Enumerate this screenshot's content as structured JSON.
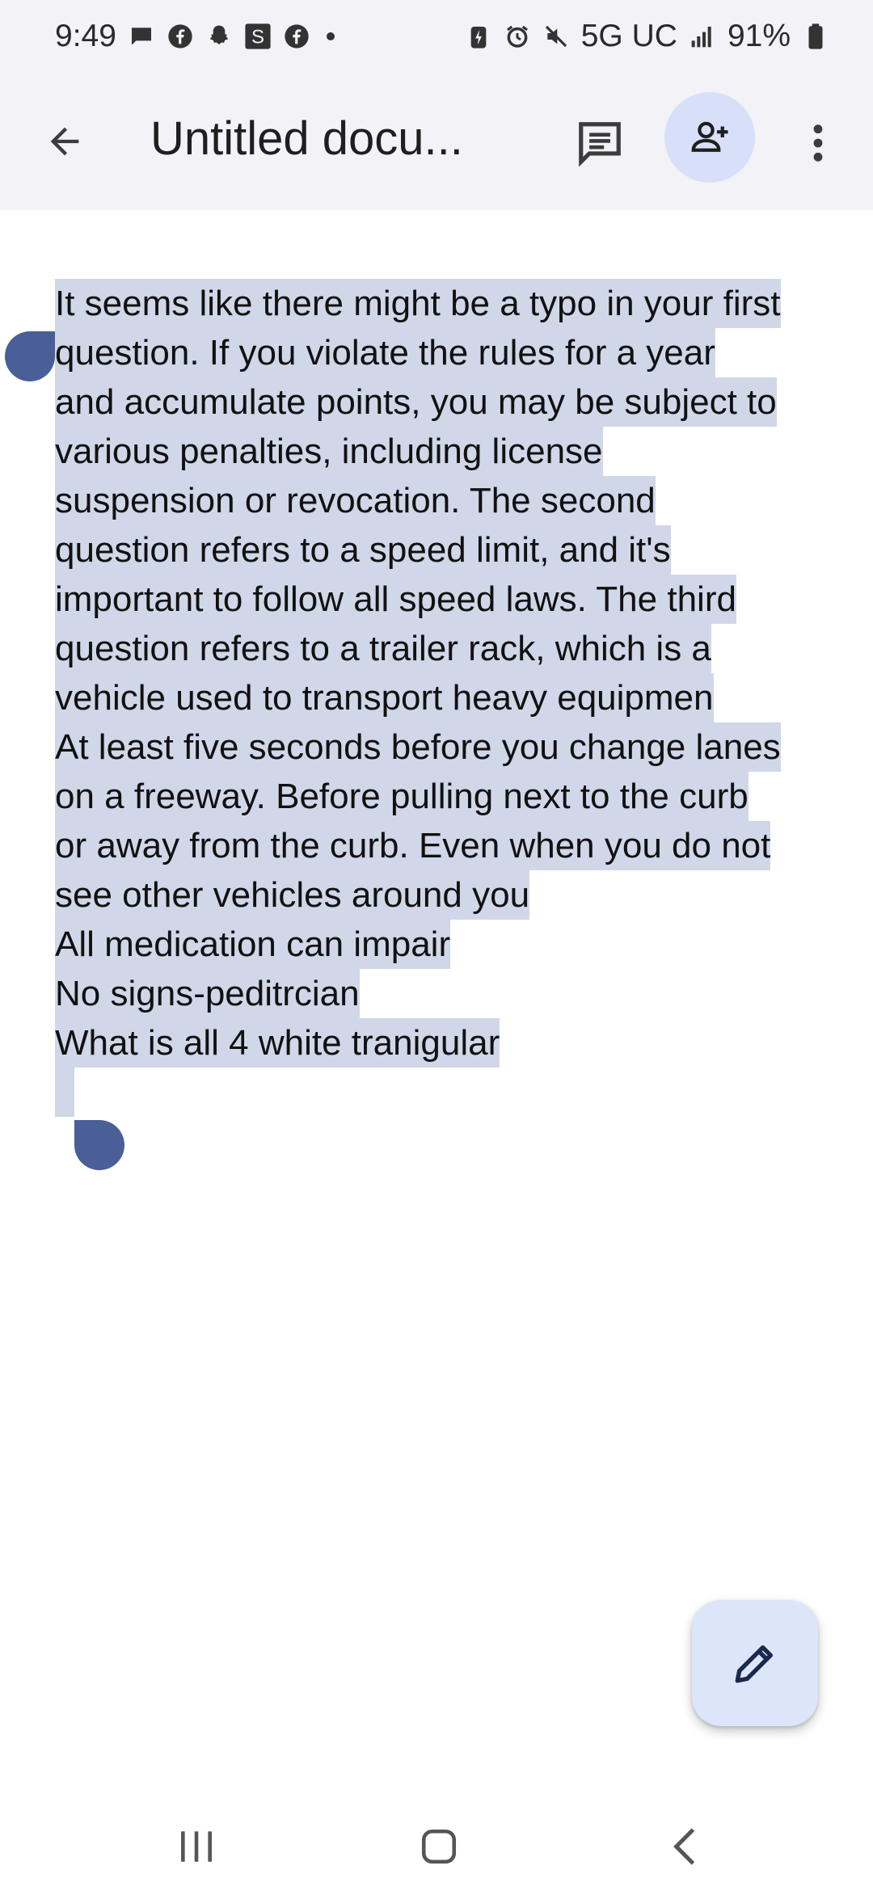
{
  "status_bar": {
    "time": "9:49",
    "network": "5G UC",
    "battery": "91%",
    "left_icons": [
      "messages-icon",
      "facebook-icon",
      "snapchat-icon",
      "s-app-icon",
      "facebook-icon"
    ],
    "right_icons": [
      "battery-saver-icon",
      "alarm-icon",
      "mute-icon",
      "signal-icon",
      "battery-icon"
    ]
  },
  "app_bar": {
    "title": "Untitled docu...",
    "accent": "#d7e0f8"
  },
  "document": {
    "selection_color": "#d0d7e8",
    "handle_color": "#4a5f97",
    "lines": [
      "It seems like there might be a typo in your first",
      "question. If you violate the rules for a year",
      "and accumulate points, you may be subject to",
      "various penalties, including license",
      "suspension or revocation. The second",
      "question refers to a speed limit, and it's",
      "important to follow all speed laws. The third",
      "question refers to a trailer rack, which is a",
      "vehicle used to transport heavy equipmen",
      "At least five seconds before you change lanes",
      "on a freeway. Before pulling next to the curb",
      "or away from the curb. Even when you do not",
      "see other vehicles around you",
      "All medication can impair",
      "No signs-peditrcian",
      "What is all 4 white tranigular"
    ]
  }
}
